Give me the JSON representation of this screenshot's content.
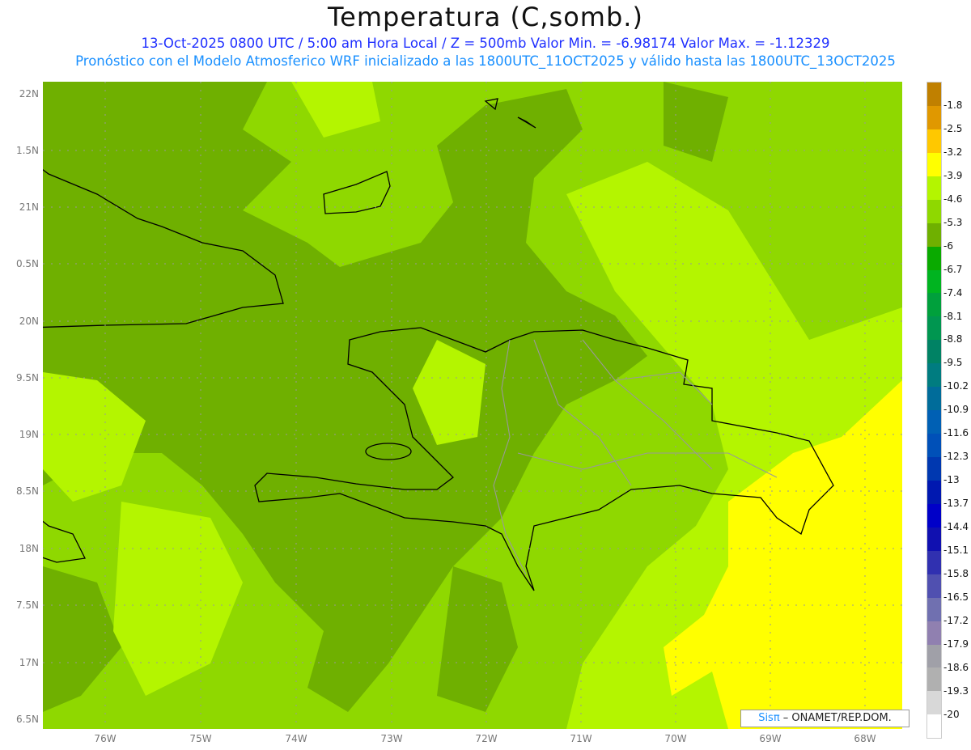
{
  "title": "Temperatura (C,somb.)",
  "subtitle1": "13-Oct-2025  0800 UTC / 5:00 am Hora Local / Z = 500mb  Valor Min. = -6.98174  Valor Max. = -1.12329",
  "subtitle2": "Pronóstico con el Modelo Atmosferico WRF inicializado a las 1800UTC_11OCT2025 y válido hasta las  1800UTC_13OCT2025",
  "y_labels": [
    "22N",
    "1.5N",
    "21N",
    "0.5N",
    "20N",
    "9.5N",
    "19N",
    "8.5N",
    "18N",
    "7.5N",
    "17N",
    "6.5N"
  ],
  "x_labels": [
    "76W",
    "75W",
    "74W",
    "73W",
    "72W",
    "71W",
    "70W",
    "69W",
    "68W"
  ],
  "colorbar": {
    "labels": [
      "-1.8",
      "-2.5",
      "-3.2",
      "-3.9",
      "-4.6",
      "-5.3",
      "-6",
      "-6.7",
      "-7.4",
      "-8.1",
      "-8.8",
      "-9.5",
      "-10.2",
      "-10.9",
      "-11.6",
      "-12.3",
      "-13",
      "-13.7",
      "-14.4",
      "-15.1",
      "-15.8",
      "-16.5",
      "-17.2",
      "-17.9",
      "-18.6",
      "-19.3",
      "-20"
    ],
    "colors": [
      "#c08000",
      "#e09800",
      "#ffc800",
      "#ffff00",
      "#b4f500",
      "#8fd800",
      "#6fb000",
      "#0aaa00",
      "#00b420",
      "#00a03c",
      "#009650",
      "#008264",
      "#007c80",
      "#006c9a",
      "#0060b4",
      "#0050b8",
      "#0038b0",
      "#0018b0",
      "#0000c8",
      "#1010b0",
      "#3030b0",
      "#5050b0",
      "#7070b0",
      "#9080b0",
      "#a0a0a8",
      "#b0b0b0",
      "#d8d8d8",
      "#ffffff"
    ]
  },
  "credit": {
    "brand": "Sisπ",
    "text": " –  ONAMET/REP.DOM."
  }
}
